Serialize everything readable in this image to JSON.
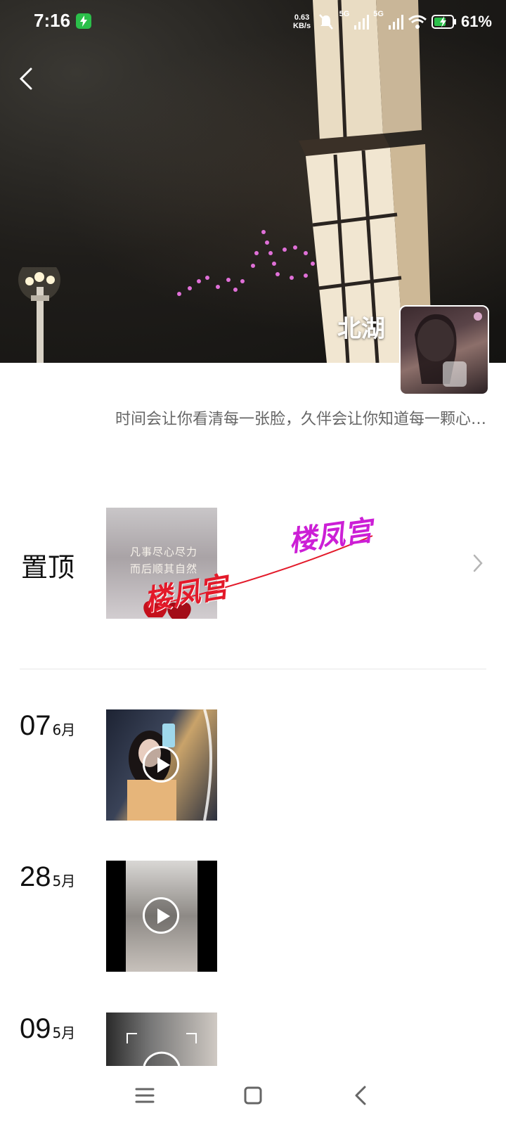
{
  "status_bar": {
    "time": "7:16",
    "net_speed_value": "0.63",
    "net_speed_unit": "KB/s",
    "signal_1_label": "5G",
    "signal_2_label": "5G",
    "battery": "61%"
  },
  "profile": {
    "nickname": "北湖",
    "signature": "时间会让你看清每一张脸，久伴会让你知道每一颗心…"
  },
  "pinned": {
    "label": "置顶",
    "thumb_text_line1": "凡事尽心尽力",
    "thumb_text_line2": "而后顺其自然",
    "watermark_1": "楼凤宫",
    "watermark_2": "楼凤宫"
  },
  "posts": [
    {
      "day": "07",
      "month": "6月"
    },
    {
      "day": "28",
      "month": "5月"
    },
    {
      "day": "09",
      "month": "5月"
    }
  ],
  "icons": {
    "back": "back-arrow-icon",
    "chevron": "chevron-right-icon",
    "play": "play-icon",
    "nav_menu": "menu-icon",
    "nav_home": "home-square-icon",
    "nav_back": "back-triangle-icon"
  },
  "colors": {
    "watermark_red": "#e31a2a",
    "watermark_purple": "#cc1fd6",
    "charging_green": "#2bbf4a"
  }
}
